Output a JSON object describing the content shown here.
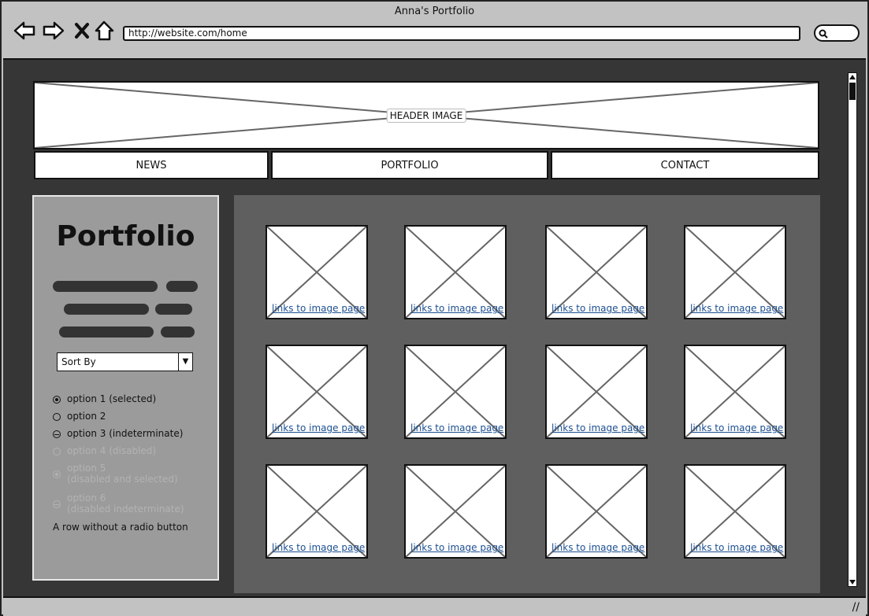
{
  "window": {
    "title": "Anna's Portfolio"
  },
  "address_bar": {
    "url": "http://website.com/home"
  },
  "header": {
    "image_label": "HEADER IMAGE"
  },
  "nav": {
    "tabs": [
      {
        "label": "NEWS"
      },
      {
        "label": "PORTFOLIO"
      },
      {
        "label": "CONTACT"
      }
    ]
  },
  "sidebar": {
    "title": "Portfolio",
    "sort_select": {
      "value": "Sort By"
    },
    "options": [
      {
        "label": "option 1 (selected)",
        "state": "selected",
        "disabled": false
      },
      {
        "label": "option 2",
        "state": "unselected",
        "disabled": false
      },
      {
        "label": "option 3 (indeterminate)",
        "state": "indeterminate",
        "disabled": false
      },
      {
        "label": "option 4 (disabled)",
        "state": "unselected",
        "disabled": true
      },
      {
        "label": "option 5",
        "label2": "(disabled and selected)",
        "state": "selected",
        "disabled": true
      },
      {
        "label": "option 6",
        "label2": "(disabled indeterminate)",
        "state": "indeterminate",
        "disabled": true
      }
    ],
    "plain_row": "A row without a radio button"
  },
  "gallery": {
    "link_text": "links to image page",
    "link_color": "#1d4f91",
    "item_count": 12
  },
  "colors": {
    "viewport_bg": "#363636",
    "content_bg": "#5f5f5f",
    "sidebar_bg": "#9b9b9b",
    "chrome_bg": "#c2c2c2"
  }
}
